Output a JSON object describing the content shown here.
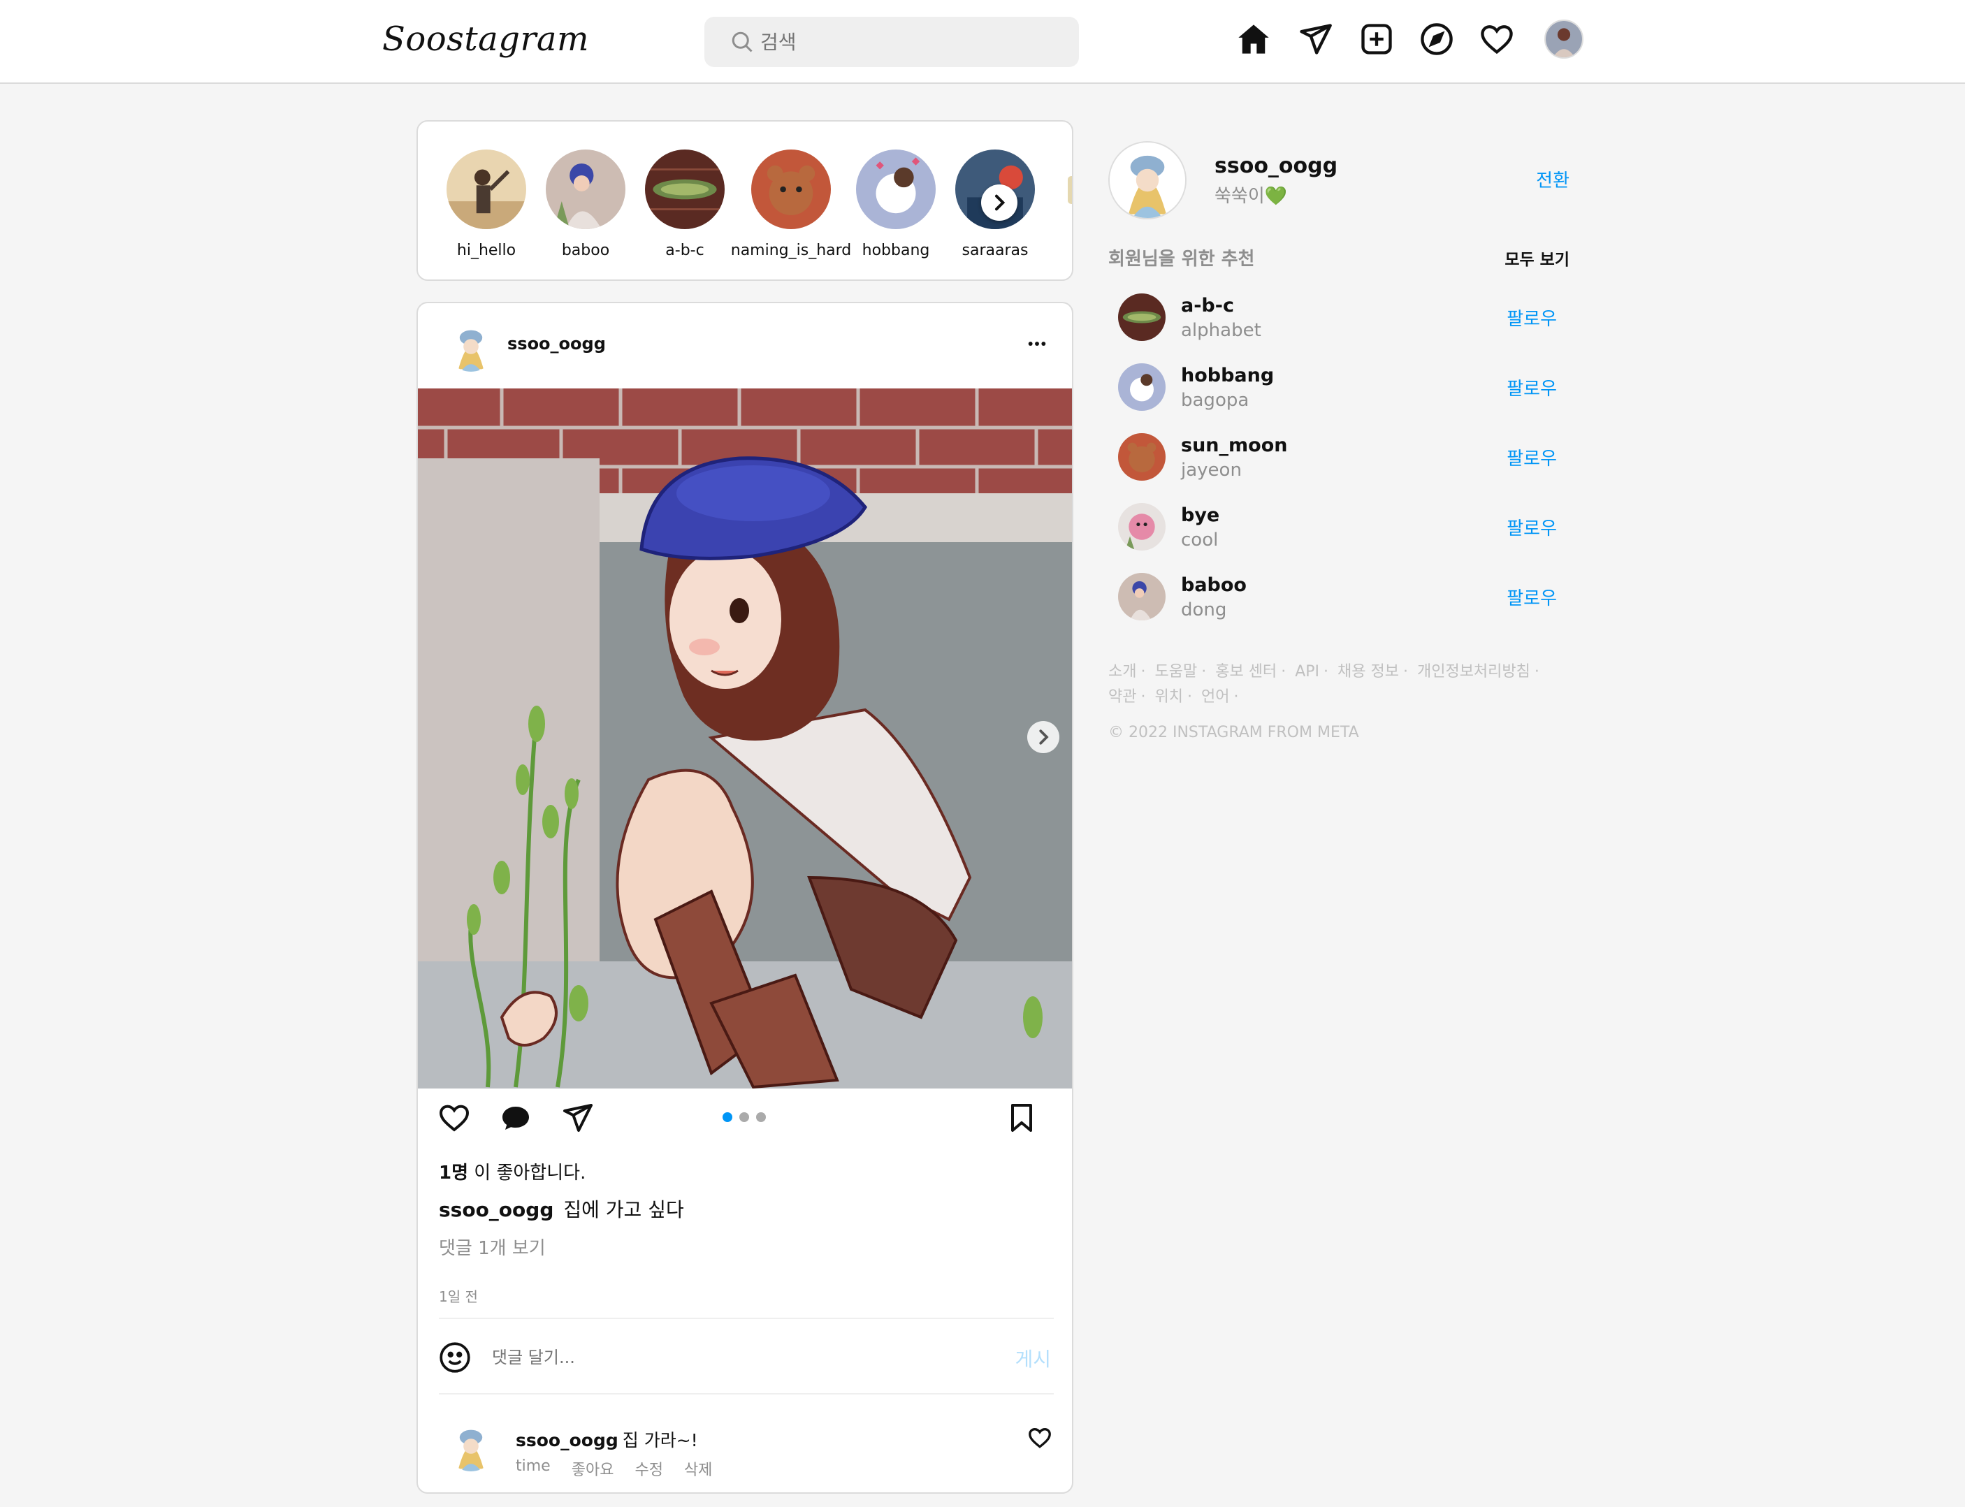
{
  "header": {
    "logo": "Soostagram",
    "search_placeholder": "검색"
  },
  "stories": [
    {
      "name": "hi_hello"
    },
    {
      "name": "baboo"
    },
    {
      "name": "a-b-c"
    },
    {
      "name": "naming_is_hard"
    },
    {
      "name": "hobbang"
    },
    {
      "name": "saraaras"
    }
  ],
  "post": {
    "username": "ssoo_oogg",
    "likes_count": "1명",
    "likes_suffix": " 이 좋아합니다.",
    "caption_user": "ssoo_oogg",
    "caption_text": "집에 가고 싶다",
    "view_comments": "댓글 1개 보기",
    "time": "1일 전",
    "comment_placeholder": "댓글 달기...",
    "post_button": "게시",
    "carousel": {
      "count": 3,
      "active": 0
    },
    "comment": {
      "user": "ssoo_oogg",
      "text": "집 가라~!",
      "time": "time",
      "like": "좋아요",
      "edit": "수정",
      "delete": "삭제"
    }
  },
  "me": {
    "username": "ssoo_oogg",
    "nickname": "쑥쑥이💚",
    "switch": "전환"
  },
  "recommend": {
    "title": "회원님을 위한 추천",
    "see_all": "모두 보기",
    "follow_label": "팔로우",
    "items": [
      {
        "user": "a-b-c",
        "sub": "alphabet"
      },
      {
        "user": "hobbang",
        "sub": "bagopa"
      },
      {
        "user": "sun_moon",
        "sub": "jayeon"
      },
      {
        "user": "bye",
        "sub": "cool"
      },
      {
        "user": "baboo",
        "sub": "dong"
      }
    ]
  },
  "footer": {
    "links": [
      "소개",
      "도움말",
      "홍보 센터",
      "API",
      "채용 정보",
      "개인정보처리방침",
      "약관",
      "위치",
      "언어"
    ],
    "copyright": "© 2022 INSTAGRAM FROM META"
  },
  "colors": {
    "accent": "#0095f6",
    "muted": "#8e8e8e",
    "background": "#f5f5f5"
  }
}
